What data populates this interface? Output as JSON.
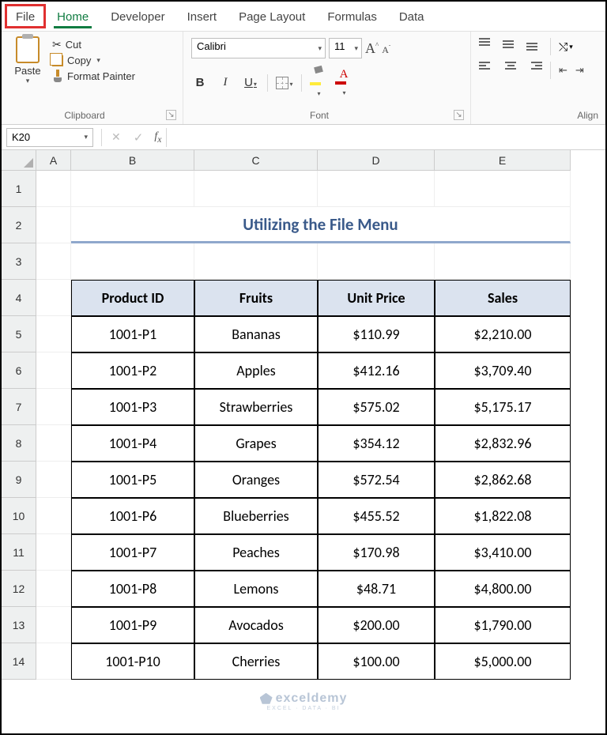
{
  "tabs": {
    "file": "File",
    "home": "Home",
    "developer": "Developer",
    "insert": "Insert",
    "pagelayout": "Page Layout",
    "formulas": "Formulas",
    "data": "Data"
  },
  "ribbon": {
    "clipboard": {
      "paste": "Paste",
      "cut": "Cut",
      "copy": "Copy",
      "formatPainter": "Format Painter",
      "label": "Clipboard"
    },
    "font": {
      "name": "Calibri",
      "size": "11",
      "bold": "B",
      "italic": "I",
      "underline": "U",
      "label": "Font"
    },
    "align": {
      "label": "Align"
    }
  },
  "namebox": "K20",
  "columns": [
    "A",
    "B",
    "C",
    "D",
    "E"
  ],
  "rowNumbers": [
    "1",
    "2",
    "3",
    "4",
    "5",
    "6",
    "7",
    "8",
    "9",
    "10",
    "11",
    "12",
    "13",
    "14"
  ],
  "title": "Utilizing the File Menu",
  "table": {
    "headers": [
      "Product ID",
      "Fruits",
      "Unit Price",
      "Sales"
    ],
    "rows": [
      [
        "1001-P1",
        "Bananas",
        "$110.99",
        "$2,210.00"
      ],
      [
        "1001-P2",
        "Apples",
        "$412.16",
        "$3,709.40"
      ],
      [
        "1001-P3",
        "Strawberries",
        "$575.02",
        "$5,175.17"
      ],
      [
        "1001-P4",
        "Grapes",
        "$354.12",
        "$2,832.96"
      ],
      [
        "1001-P5",
        "Oranges",
        "$572.54",
        "$2,862.68"
      ],
      [
        "1001-P6",
        "Blueberries",
        "$455.52",
        "$1,822.08"
      ],
      [
        "1001-P7",
        "Peaches",
        "$170.98",
        "$3,410.00"
      ],
      [
        "1001-P8",
        "Lemons",
        "$48.71",
        "$4,800.00"
      ],
      [
        "1001-P9",
        "Avocados",
        "$200.00",
        "$1,790.00"
      ],
      [
        "1001-P10",
        "Cherries",
        "$100.00",
        "$5,000.00"
      ]
    ]
  },
  "watermark": {
    "brand": "exceldemy",
    "sub": "EXCEL · DATA · BI"
  }
}
